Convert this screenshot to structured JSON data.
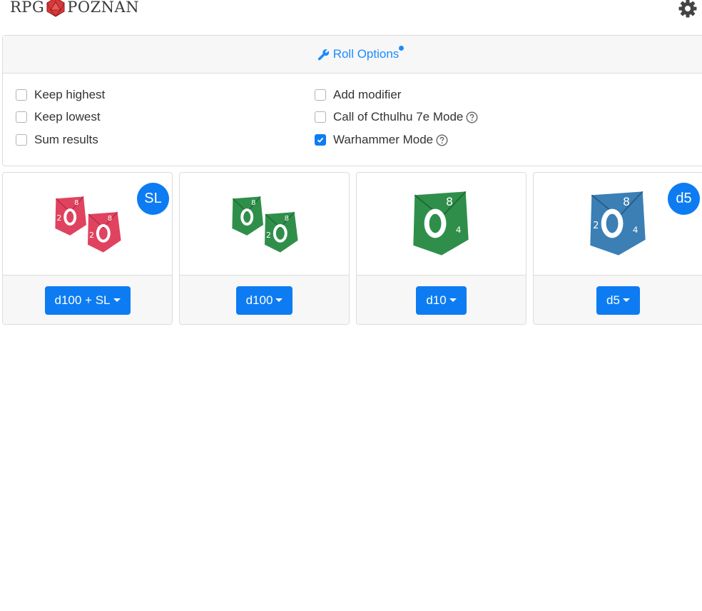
{
  "header": {
    "logo_left": "RPG",
    "logo_right": "POZNAŃ",
    "settings_icon": "gear-icon"
  },
  "roll_options": {
    "title": "Roll Options",
    "icon": "wrench-icon",
    "options": [
      {
        "label": "Keep highest",
        "checked": false,
        "help": false
      },
      {
        "label": "Keep lowest",
        "checked": false,
        "help": false
      },
      {
        "label": "Sum results",
        "checked": false,
        "help": false
      },
      {
        "label": "Add modifier",
        "checked": false,
        "help": false
      },
      {
        "label": "Call of Cthulhu 7e Mode",
        "checked": false,
        "help": true
      },
      {
        "label": "Warhammer Mode",
        "checked": true,
        "help": true
      }
    ]
  },
  "dice": [
    {
      "button_label": "d100 + SL",
      "badge": "SL",
      "dice_color": "#e0435f",
      "count": 2
    },
    {
      "button_label": "d100",
      "badge": "",
      "dice_color": "#2f8f4a",
      "count": 2
    },
    {
      "button_label": "d10",
      "badge": "",
      "dice_color": "#2f8f4a",
      "count": 1
    },
    {
      "button_label": "d5",
      "badge": "d5",
      "dice_color": "#3b7fb5",
      "count": 1
    }
  ],
  "colors": {
    "accent": "#0d7cf2",
    "link": "#1a8cff"
  }
}
